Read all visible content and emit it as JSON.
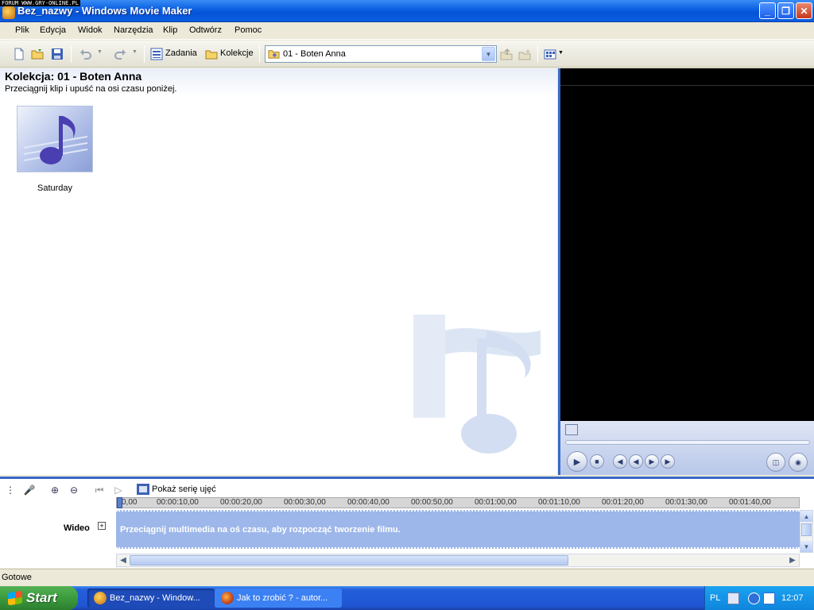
{
  "window": {
    "title": "Bez_nazwy - Windows Movie Maker",
    "watermark": "FORUM WWW.GRY-ONLINE.PL"
  },
  "menu": [
    "Plik",
    "Edycja",
    "Widok",
    "Narzędzia",
    "Klip",
    "Odtwórz",
    "Pomoc"
  ],
  "toolbar": {
    "tasks_label": "Zadania",
    "collections_label": "Kolekcje",
    "collection_select": "01 - Boten Anna"
  },
  "collection": {
    "title": "Kolekcja: 01 - Boten Anna",
    "hint": "Przeciągnij klip i upuść na osi czasu poniżej.",
    "clips": [
      {
        "name": "Saturday"
      }
    ]
  },
  "timeline": {
    "storyboard_label": "Pokaż serię ujęć",
    "ruler_ticks": [
      "0,00",
      "00:00:10,00",
      "00:00:20,00",
      "00:00:30,00",
      "00:00:40,00",
      "00:00:50,00",
      "00:01:00,00",
      "00:01:10,00",
      "00:01:20,00",
      "00:01:30,00",
      "00:01:40,00"
    ],
    "track_name": "Wideo",
    "track_hint": "Przeciągnij multimedia na oś czasu, aby rozpocząć tworzenie filmu."
  },
  "status": {
    "text": "Gotowe"
  },
  "taskbar": {
    "start_label": "Start",
    "tasks": [
      "Bez_nazwy - Window...",
      "Jak to zrobić ? - autor..."
    ],
    "language": "PL",
    "clock": "12:07"
  },
  "colors": {
    "title_blue": "#0a5fe0",
    "accent_blue": "#3869c7",
    "track_blue": "#9db7ea",
    "start_green": "#3c9b3e"
  }
}
